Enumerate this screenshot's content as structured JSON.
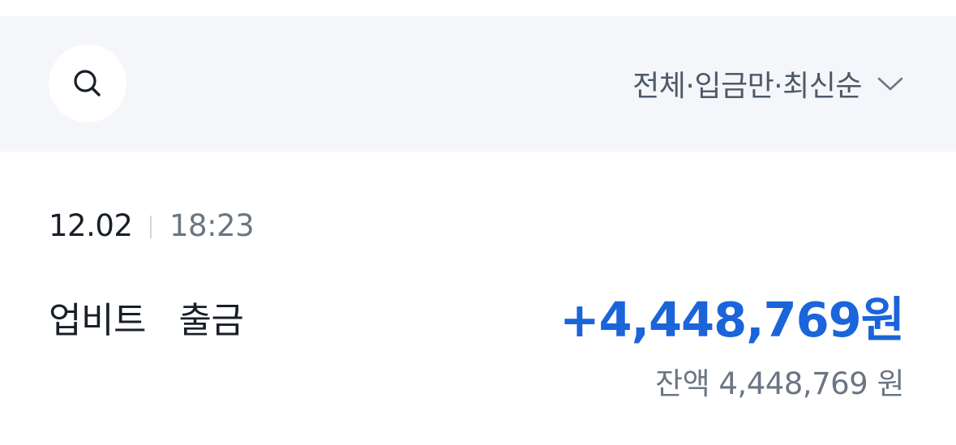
{
  "filter": {
    "search_icon": "search-icon",
    "label": "전체·입금만·최신순",
    "chevron_icon": "chevron-down-icon"
  },
  "transaction": {
    "date": "12.02",
    "time": "18:23",
    "description": "업비트   출금",
    "amount": "+4,448,769원",
    "balance": "잔액 4,448,769 원",
    "amount_color": "#1b64da"
  }
}
